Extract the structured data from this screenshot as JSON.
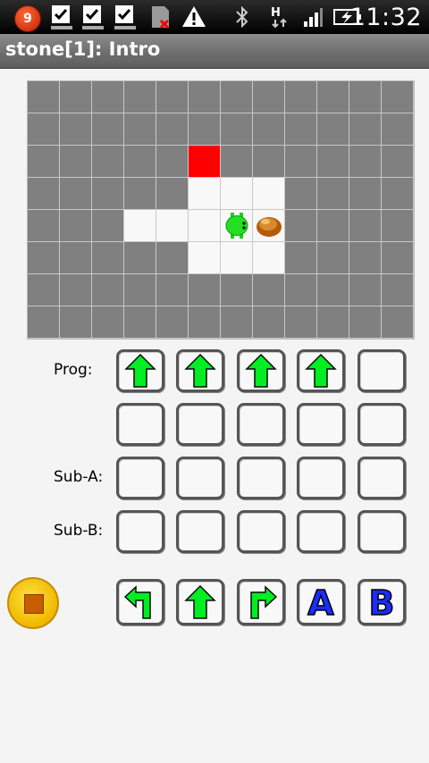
{
  "status_bar": {
    "notification_count": "9",
    "clock": "11:32"
  },
  "titlebar": {
    "title": "stone[1]: Intro"
  },
  "board": {
    "cols": 12,
    "rows": 8,
    "floor_cells": [
      [
        5,
        3
      ],
      [
        6,
        3
      ],
      [
        7,
        3
      ],
      [
        3,
        4
      ],
      [
        4,
        4
      ],
      [
        5,
        4
      ],
      [
        6,
        4
      ],
      [
        7,
        4
      ],
      [
        5,
        5
      ],
      [
        6,
        5
      ],
      [
        7,
        5
      ]
    ],
    "goal_cell": [
      5,
      2
    ],
    "robot_cell": [
      6,
      4
    ],
    "stone_cell": [
      7,
      4
    ]
  },
  "program": {
    "rows": [
      {
        "label": "Prog:",
        "slots": [
          "forward",
          "forward",
          "forward",
          "forward",
          ""
        ]
      },
      {
        "label": "",
        "slots": [
          "",
          "",
          "",
          "",
          ""
        ]
      },
      {
        "label": "Sub-A:",
        "slots": [
          "",
          "",
          "",
          "",
          ""
        ]
      },
      {
        "label": "Sub-B:",
        "slots": [
          "",
          "",
          "",
          "",
          ""
        ]
      }
    ],
    "palette": [
      {
        "cmd": "turn-left"
      },
      {
        "cmd": "forward"
      },
      {
        "cmd": "turn-right"
      },
      {
        "cmd": "call-a",
        "text": "A"
      },
      {
        "cmd": "call-b",
        "text": "B"
      }
    ]
  },
  "colors": {
    "arrow": "#00ee22",
    "goal": "#ff0000",
    "letter": "#1a2cff"
  }
}
